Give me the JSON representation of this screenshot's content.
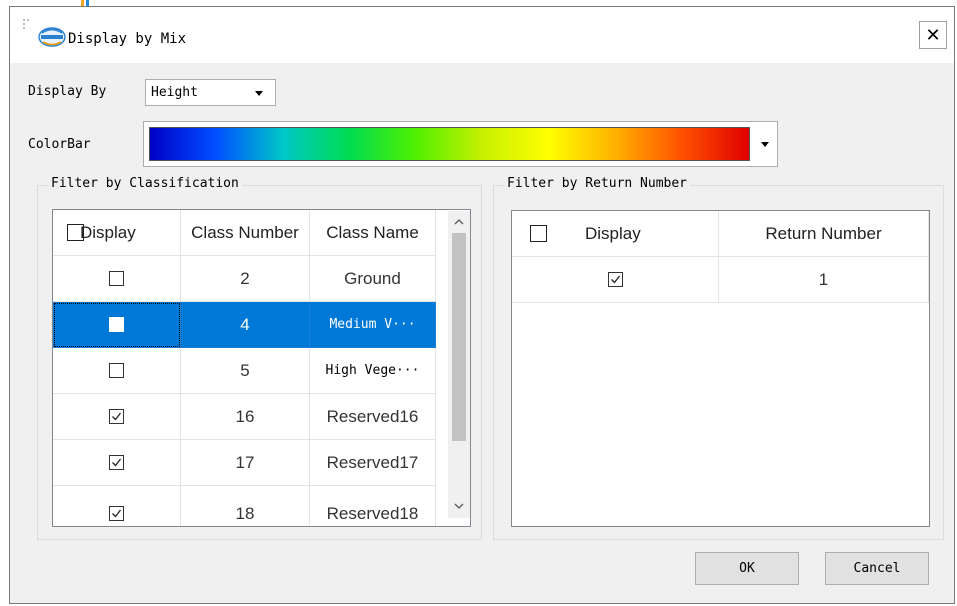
{
  "dialog": {
    "title": "Display by Mix",
    "display_by_label": "Display By",
    "display_by_value": "Height",
    "colorbar_label": "ColorBar",
    "colorbar_stops": [
      "#0000c8",
      "#0050ff",
      "#00c8c8",
      "#00dc50",
      "#50f000",
      "#c8f000",
      "#ffff00",
      "#ffb000",
      "#ff5000",
      "#e00000"
    ]
  },
  "classification": {
    "group_title": "Filter by Classification",
    "headers": [
      "Display",
      "Class Number",
      "Class Name"
    ],
    "rows": [
      {
        "checked": false,
        "number": "2",
        "name": "Ground",
        "selected": false
      },
      {
        "checked": false,
        "number": "4",
        "name": "Medium V···",
        "selected": true
      },
      {
        "checked": false,
        "number": "5",
        "name": "High Vege···",
        "selected": false
      },
      {
        "checked": true,
        "number": "16",
        "name": "Reserved16",
        "selected": false
      },
      {
        "checked": true,
        "number": "17",
        "name": "Reserved17",
        "selected": false
      },
      {
        "checked": true,
        "number": "18",
        "name": "Reserved18",
        "selected": false
      }
    ]
  },
  "return_number": {
    "group_title": "Filter by Return Number",
    "headers": [
      "Display",
      "Return Number"
    ],
    "rows": [
      {
        "checked": true,
        "number": "1"
      }
    ]
  },
  "buttons": {
    "ok": "OK",
    "cancel": "Cancel"
  },
  "colors": {
    "selection": "#0078d7",
    "dialog_bg": "#f0f0f0"
  }
}
